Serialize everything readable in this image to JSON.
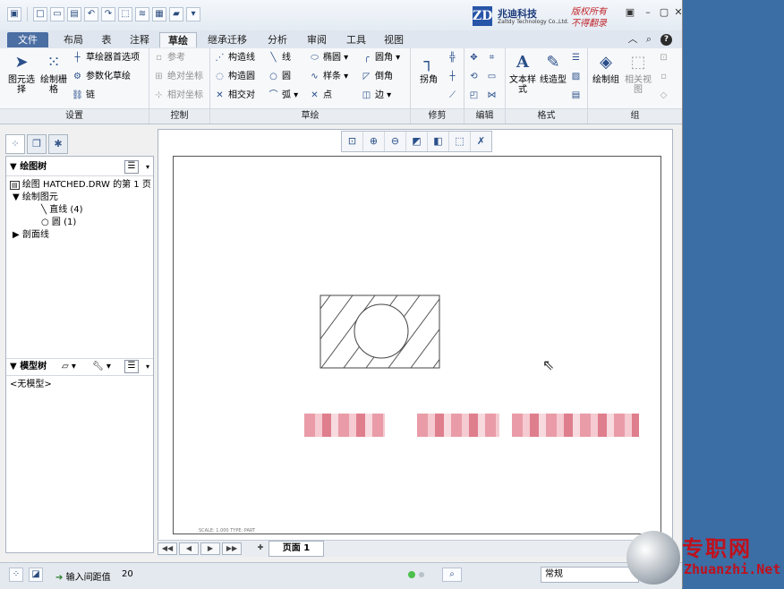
{
  "logo": {
    "mark": "ZD",
    "company_cn": "兆迪科技",
    "company_en": "Zaltdy Technology Co.,Ltd.",
    "rights_line1": "版权所有",
    "rights_line2": "不得翻录"
  },
  "tabs": [
    "文件",
    "布局",
    "表",
    "注释",
    "草绘",
    "继承迁移",
    "分析",
    "审阅",
    "工具",
    "视图"
  ],
  "ribbon": {
    "settings": {
      "label": "设置",
      "select_label": "图元选择",
      "grid_label": "绘制栅格",
      "prefs": "草绘器首选项",
      "param_sketch": "参数化草绘",
      "chain": "链"
    },
    "control": {
      "label": "控制",
      "ref": "参考",
      "abs_coord": "绝对坐标",
      "rel_coord": "相对坐标"
    },
    "sketch": {
      "label": "草绘",
      "construct_line": "构造线",
      "construct_circle": "构造圆",
      "intersect": "相交对",
      "line": "线",
      "circle": "圆",
      "arc": "弧",
      "ellipse": "椭圆",
      "spline": "样条",
      "point": "点",
      "fillet": "圆角",
      "chamfer": "倒角",
      "edge": "边"
    },
    "trim": {
      "label": "修剪",
      "corner": "拐角"
    },
    "edit": {
      "label": "编辑"
    },
    "format": {
      "label": "格式",
      "text_style": "文本样式",
      "line_type": "线造型"
    },
    "group": {
      "label": "组",
      "draw_group": "绘制组",
      "related_view": "相关视图"
    }
  },
  "left_panel": {
    "drawing_tree_title": "绘图树",
    "root": "绘图 HATCHED.DRW 的第 1 页",
    "node_sketched": "绘制图元",
    "node_line": "直线 (4)",
    "node_circle": "圆 (1)",
    "node_section": "剖面线",
    "model_tree_title": "模型树",
    "no_model": "<无模型>"
  },
  "page_bar": {
    "page_label": "页面 1"
  },
  "status": {
    "message": "输入间距值",
    "value": "20",
    "filter": "常规"
  },
  "sheet_note": "SCALE: 1.000   TYPE: PART",
  "watermark": {
    "cn": "专职网",
    "url": "Zhuanzhi.Net"
  }
}
